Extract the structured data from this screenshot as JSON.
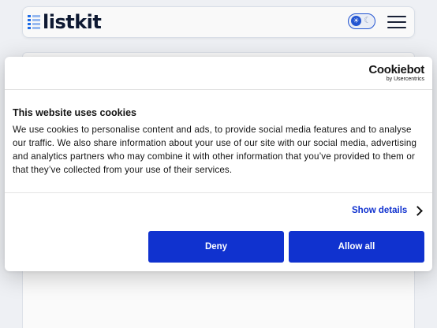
{
  "header": {
    "logo_text": "listkit",
    "theme_toggle": {
      "active_icon": "sun-icon",
      "inactive_icon": "moon-icon",
      "sun_glyph": "☀",
      "moon_glyph": "☾"
    },
    "menu_icon": "hamburger-menu-icon"
  },
  "cookie_banner": {
    "brand_name": "Cookiebot",
    "brand_sub": "by Usercentrics",
    "title": "This website uses cookies",
    "description": "We use cookies to personalise content and ads, to provide social media features and to analyse our traffic. We also share information about your use of our site with our social media, advertising and analytics partners who may combine it with other information that you’ve provided to them or that they’ve collected from your use of their services.",
    "show_details_label": "Show details",
    "deny_label": "Deny",
    "allow_all_label": "Allow all"
  },
  "colors": {
    "accent": "#1032cf",
    "brand_blue": "#1f6feb",
    "page_bg": "#f3f5f9"
  }
}
